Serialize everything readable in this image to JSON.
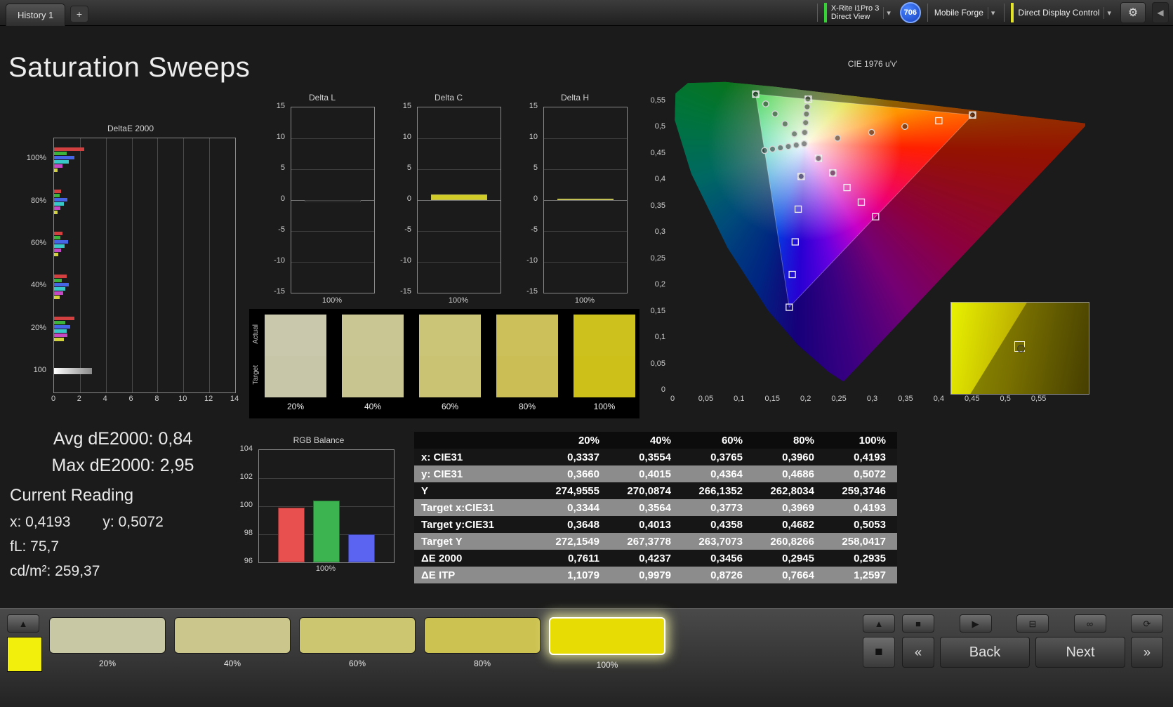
{
  "topbar": {
    "history_tab": "History 1",
    "meter_line1": "X-Rite i1Pro 3",
    "meter_line2": "Direct View",
    "badge": "706",
    "pattern_source": "Mobile Forge",
    "display_control": "Direct Display Control"
  },
  "icons": {
    "add": "+",
    "chevron_down": "▾",
    "gear": "⚙",
    "collapse_left": "◀",
    "up_arrow": "▲",
    "stop": "■",
    "play": "▶",
    "capture": "⊟",
    "continuous": "∞",
    "repeat": "⟳",
    "prev": "«",
    "next": "»",
    "stop_large": "■"
  },
  "page": {
    "title": "Saturation Sweeps"
  },
  "stats": {
    "avg": "Avg dE2000: 0,84",
    "max": "Max dE2000: 2,95",
    "current_heading": "Current Reading",
    "x": "x: 0,4193",
    "y": "y: 0,5072",
    "fl": "fL: 75,7",
    "cdm2": "cd/m²: 259,37"
  },
  "chart_data": {
    "deltae2000": {
      "type": "bar",
      "title": "DeltaE 2000",
      "orientation": "horizontal",
      "xlim": [
        0,
        14
      ],
      "x_ticks": [
        0,
        2,
        4,
        6,
        8,
        10,
        12,
        14
      ],
      "groups": [
        {
          "label": "100%",
          "bars": [
            {
              "color": "#d24040",
              "value": 2.35
            },
            {
              "color": "#3cb43c",
              "value": 0.95
            },
            {
              "color": "#4664e6",
              "value": 1.55
            },
            {
              "color": "#38c8c8",
              "value": 1.15
            },
            {
              "color": "#c448c4",
              "value": 0.65
            },
            {
              "color": "#d2d23c",
              "value": 0.29
            }
          ]
        },
        {
          "label": "80%",
          "bars": [
            {
              "color": "#d24040",
              "value": 0.55
            },
            {
              "color": "#3cb43c",
              "value": 0.45
            },
            {
              "color": "#4664e6",
              "value": 1.05
            },
            {
              "color": "#38c8c8",
              "value": 0.75
            },
            {
              "color": "#c448c4",
              "value": 0.5
            },
            {
              "color": "#d2d23c",
              "value": 0.29
            }
          ]
        },
        {
          "label": "60%",
          "bars": [
            {
              "color": "#d24040",
              "value": 0.65
            },
            {
              "color": "#3cb43c",
              "value": 0.5
            },
            {
              "color": "#4664e6",
              "value": 1.1
            },
            {
              "color": "#38c8c8",
              "value": 0.8
            },
            {
              "color": "#c448c4",
              "value": 0.55
            },
            {
              "color": "#d2d23c",
              "value": 0.35
            }
          ]
        },
        {
          "label": "40%",
          "bars": [
            {
              "color": "#d24040",
              "value": 0.95
            },
            {
              "color": "#3cb43c",
              "value": 0.6
            },
            {
              "color": "#4664e6",
              "value": 1.15
            },
            {
              "color": "#38c8c8",
              "value": 0.85
            },
            {
              "color": "#c448c4",
              "value": 0.7
            },
            {
              "color": "#d2d23c",
              "value": 0.42
            }
          ]
        },
        {
          "label": "20%",
          "bars": [
            {
              "color": "#d24040",
              "value": 1.55
            },
            {
              "color": "#3cb43c",
              "value": 0.85
            },
            {
              "color": "#4664e6",
              "value": 1.25
            },
            {
              "color": "#38c8c8",
              "value": 0.95
            },
            {
              "color": "#c448c4",
              "value": 1.05
            },
            {
              "color": "#d2d23c",
              "value": 0.76
            }
          ]
        },
        {
          "label": "100",
          "bars": [
            {
              "color": "white-gradient",
              "value": 2.95
            }
          ]
        }
      ]
    },
    "delta_l": {
      "type": "bar",
      "title": "Delta L",
      "ylim": [
        -15,
        15
      ],
      "y_ticks": [
        15,
        10,
        5,
        0,
        -5,
        -10,
        -15
      ],
      "x_label": "100%",
      "value": -0.2,
      "color": "#0a0a0a"
    },
    "delta_c": {
      "type": "bar",
      "title": "Delta C",
      "ylim": [
        -15,
        15
      ],
      "y_ticks": [
        15,
        10,
        5,
        0,
        -5,
        -10,
        -15
      ],
      "x_label": "100%",
      "value": 0.9,
      "color": "#d2cc28"
    },
    "delta_h": {
      "type": "bar",
      "title": "Delta H",
      "ylim": [
        -15,
        15
      ],
      "y_ticks": [
        15,
        10,
        5,
        0,
        -5,
        -10,
        -15
      ],
      "x_label": "100%",
      "value": 0.25,
      "color": "#d2cc28"
    },
    "rgb_balance": {
      "type": "bar",
      "title": "RGB Balance",
      "ylim": [
        96,
        104
      ],
      "y_ticks": [
        104,
        102,
        100,
        98,
        96
      ],
      "x_label": "100%",
      "categories": [
        "red",
        "green",
        "blue"
      ],
      "values": [
        99.9,
        100.4,
        98.0
      ],
      "colors": [
        "#e85050",
        "#3cb450",
        "#5a64f0"
      ]
    },
    "cie": {
      "type": "scatter",
      "title": "CIE 1976 u'v'",
      "u_max": 0.62,
      "v_max": 0.6,
      "tick_values": [
        0,
        0.05,
        0.1,
        0.15,
        0.2,
        0.25,
        0.3,
        0.35,
        0.4,
        0.45,
        0.5,
        0.55
      ],
      "tick_labels": [
        "0",
        "0,05",
        "0,1",
        "0,15",
        "0,2",
        "0,25",
        "0,3",
        "0,35",
        "0,4",
        "0,45",
        "0,5",
        "0,55"
      ],
      "locus": [
        [
          0.2568,
          0.0166
        ],
        [
          0.2347,
          0.035
        ],
        [
          0.1877,
          0.0871
        ],
        [
          0.1441,
          0.151
        ],
        [
          0.0828,
          0.2708
        ],
        [
          0.0282,
          0.4117
        ],
        [
          0.0035,
          0.5131
        ],
        [
          0.0046,
          0.5639
        ],
        [
          0.0231,
          0.5836
        ],
        [
          0.0792,
          0.5856
        ],
        [
          0.1531,
          0.5766
        ],
        [
          0.2623,
          0.5604
        ],
        [
          0.4035,
          0.5393
        ],
        [
          0.5203,
          0.5219
        ],
        [
          0.6234,
          0.5065
        ]
      ],
      "gamut": [
        [
          0.4507,
          0.5229
        ],
        [
          0.125,
          0.5625
        ],
        [
          0.1754,
          0.1579
        ]
      ],
      "squares": [
        [
          0.1978,
          0.4683
        ],
        [
          0.2039,
          0.5529
        ],
        [
          0.4507,
          0.5229
        ],
        [
          0.125,
          0.5625
        ],
        [
          0.1754,
          0.1579
        ],
        [
          0.1799,
          0.22
        ],
        [
          0.1843,
          0.282
        ],
        [
          0.1888,
          0.3441
        ],
        [
          0.1933,
          0.4062
        ],
        [
          0.2192,
          0.4406
        ],
        [
          0.2407,
          0.4129
        ],
        [
          0.2621,
          0.3852
        ],
        [
          0.2836,
          0.3575
        ],
        [
          0.305,
          0.3298
        ],
        [
          0.4,
          0.512
        ]
      ],
      "circles": [
        [
          0.1985,
          0.4899
        ],
        [
          0.2,
          0.5084
        ],
        [
          0.2012,
          0.5248
        ],
        [
          0.2023,
          0.5385
        ],
        [
          0.2034,
          0.5534
        ],
        [
          0.1859,
          0.4657
        ],
        [
          0.174,
          0.4632
        ],
        [
          0.1621,
          0.4606
        ],
        [
          0.1503,
          0.4581
        ],
        [
          0.1384,
          0.4555
        ],
        [
          0.183,
          0.487
        ],
        [
          0.169,
          0.506
        ],
        [
          0.154,
          0.525
        ],
        [
          0.14,
          0.544
        ],
        [
          0.125,
          0.5625
        ],
        [
          0.248,
          0.479
        ],
        [
          0.299,
          0.49
        ],
        [
          0.349,
          0.501
        ],
        [
          0.4507,
          0.5229
        ],
        [
          0.2192,
          0.4406
        ],
        [
          0.2407,
          0.4129
        ],
        [
          0.1933,
          0.4062
        ],
        [
          0.1978,
          0.4683
        ]
      ]
    }
  },
  "patch_strip": {
    "actual_label": "Actual",
    "target_label": "Target",
    "items": [
      {
        "label": "20%",
        "actual": "#c9c8ad",
        "target": "#c7c6a9"
      },
      {
        "label": "40%",
        "actual": "#cac694",
        "target": "#c9c590"
      },
      {
        "label": "60%",
        "actual": "#cbc577",
        "target": "#cac373"
      },
      {
        "label": "80%",
        "actual": "#cbc059",
        "target": "#cabe55"
      },
      {
        "label": "100%",
        "actual": "#cdc21d",
        "target": "#ccc019"
      }
    ]
  },
  "table": {
    "corner": "",
    "columns": [
      "20%",
      "40%",
      "60%",
      "80%",
      "100%"
    ],
    "rows": [
      {
        "label": "x: CIE31",
        "values": [
          "0,3337",
          "0,3554",
          "0,3765",
          "0,3960",
          "0,4193"
        ]
      },
      {
        "label": "y: CIE31",
        "values": [
          "0,3660",
          "0,4015",
          "0,4364",
          "0,4686",
          "0,5072"
        ]
      },
      {
        "label": "Y",
        "values": [
          "274,9555",
          "270,0874",
          "266,1352",
          "262,8034",
          "259,3746"
        ]
      },
      {
        "label": "Target x:CIE31",
        "values": [
          "0,3344",
          "0,3564",
          "0,3773",
          "0,3969",
          "0,4193"
        ]
      },
      {
        "label": "Target y:CIE31",
        "values": [
          "0,3648",
          "0,4013",
          "0,4358",
          "0,4682",
          "0,5053"
        ]
      },
      {
        "label": "Target Y",
        "values": [
          "272,1549",
          "267,3778",
          "263,7073",
          "260,8266",
          "258,0417"
        ]
      },
      {
        "label": "ΔE 2000",
        "values": [
          "0,7611",
          "0,4237",
          "0,3456",
          "0,2945",
          "0,2935"
        ]
      },
      {
        "label": "ΔE ITP",
        "values": [
          "1,1079",
          "0,9979",
          "0,8726",
          "0,7664",
          "1,2597"
        ]
      }
    ]
  },
  "bottombar": {
    "swatch_color": "#f2ef0c",
    "patches": [
      {
        "label": "20%",
        "color": "#c9c8a4"
      },
      {
        "label": "40%",
        "color": "#cbc78c"
      },
      {
        "label": "60%",
        "color": "#ccc670"
      },
      {
        "label": "80%",
        "color": "#ccc252"
      },
      {
        "label": "100%",
        "color": "#e8dc05"
      }
    ],
    "active_index": 4,
    "back": "Back",
    "next": "Next"
  }
}
